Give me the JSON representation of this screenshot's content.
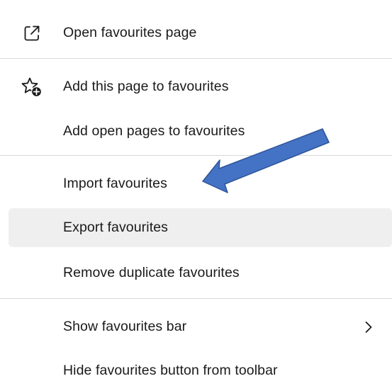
{
  "menu": {
    "items": [
      {
        "label": "Open favourites page",
        "icon": "open-external-icon"
      },
      {
        "label": "Add this page to favourites",
        "icon": "star-add-icon"
      },
      {
        "label": "Add open pages to favourites"
      },
      {
        "label": "Import favourites"
      },
      {
        "label": "Export favourites",
        "state": "hover"
      },
      {
        "label": "Remove duplicate favourites"
      },
      {
        "label": "Show favourites bar",
        "icon": "chevron-right-icon"
      },
      {
        "label": "Hide favourites button from toolbar"
      }
    ]
  },
  "annotation": {
    "type": "arrow",
    "color": "#4472c4",
    "points_to": "Import favourites"
  },
  "colors": {
    "hover_background": "#efefef",
    "divider": "#d9d9d9",
    "text": "#1a1a1a"
  }
}
